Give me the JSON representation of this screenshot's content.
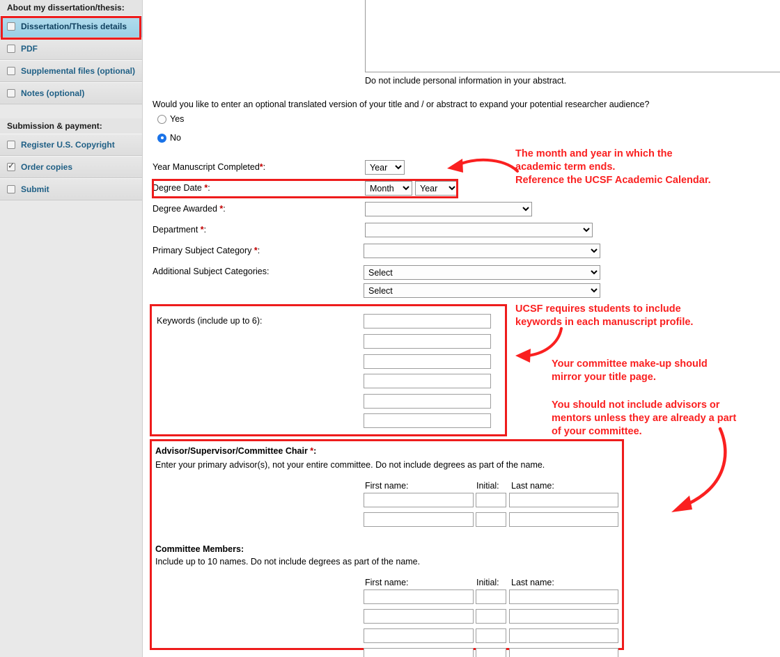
{
  "sidebar": {
    "section1_heading": "About my dissertation/thesis:",
    "section1_items": [
      {
        "label": "Dissertation/Thesis details",
        "checked": false,
        "selected": true
      },
      {
        "label": "PDF",
        "checked": false,
        "selected": false
      },
      {
        "label": "Supplemental files (optional)",
        "checked": false,
        "selected": false
      },
      {
        "label": "Notes (optional)",
        "checked": false,
        "selected": false
      }
    ],
    "section2_heading": "Submission & payment:",
    "section2_items": [
      {
        "label": "Register U.S. Copyright",
        "checked": false,
        "selected": false
      },
      {
        "label": "Order copies",
        "checked": true,
        "selected": false
      },
      {
        "label": "Submit",
        "checked": false,
        "selected": false
      }
    ]
  },
  "form": {
    "abstract_note": "Do not include personal information in your abstract.",
    "translated_question": "Would you like to enter an optional translated version of your title and / or abstract to expand your potential researcher audience?",
    "radio_yes": "Yes",
    "radio_no": "No",
    "radio_selected": "No",
    "year_manuscript_label": "Year Manuscript Completed",
    "year_manuscript_value": "Year",
    "degree_date_label": "Degree Date",
    "degree_date_month": "Month",
    "degree_date_year": "Year",
    "degree_awarded_label": "Degree Awarded",
    "degree_awarded_value": "",
    "department_label": "Department",
    "department_value": "",
    "primary_subject_label": "Primary Subject Category",
    "primary_subject_value": "",
    "additional_subject_label": "Additional Subject Categories:",
    "additional_subject_value_1": "Select",
    "additional_subject_value_2": "Select",
    "keywords_label": "Keywords (include up to 6):",
    "keyword_values": [
      "",
      "",
      "",
      "",
      "",
      ""
    ],
    "advisor_heading": "Advisor/Supervisor/Committee Chair",
    "advisor_note": "Enter your primary advisor(s), not your entire committee. Do not include degrees as part of the name.",
    "committee_heading": "Committee Members:",
    "committee_note": "Include up to 10 names. Do not include degrees as part of the name.",
    "col_first": "First name:",
    "col_initial": "Initial:",
    "col_last": "Last name:",
    "advisor_rows": [
      {
        "first": "",
        "initial": "",
        "last": ""
      },
      {
        "first": "",
        "initial": "",
        "last": ""
      }
    ],
    "committee_rows": [
      {
        "first": "",
        "initial": "",
        "last": ""
      },
      {
        "first": "",
        "initial": "",
        "last": ""
      },
      {
        "first": "",
        "initial": "",
        "last": ""
      },
      {
        "first": "",
        "initial": "",
        "last": ""
      }
    ],
    "required_marker": "*"
  },
  "annotations": {
    "degree_date_note": "The month and year in which the\nacademic term ends.\nReference the UCSF Academic Calendar.",
    "keywords_note": "UCSF requires students to include\nkeywords in each manuscript profile.",
    "committee_note_1": "Your committee make-up should\nmirror your title page.",
    "committee_note_2": "You should not include advisors or\nmentors unless they are already a part\nof your committee."
  },
  "colors": {
    "annotation_red": "#fa2020",
    "highlight_border": "#ee1c1c",
    "sidebar_selected": "#9bd0e6",
    "link_blue": "#1f5f85",
    "required_star": "#c00000"
  }
}
